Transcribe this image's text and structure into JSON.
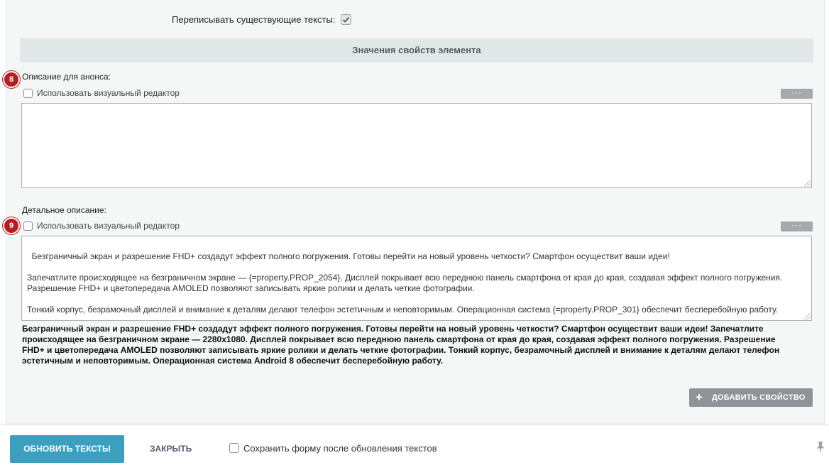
{
  "overwrite": {
    "label": "Переписывать существующие тексты:",
    "checked": true
  },
  "section": {
    "title": "Значения свойств элемента"
  },
  "preview_field": {
    "step": "8",
    "label": "Описание для анонса:",
    "visual_editor_label": "Использовать визуальный редактор",
    "more_label": "···",
    "value": ""
  },
  "detail_field": {
    "step": "9",
    "label": "Детальное описание:",
    "visual_editor_label": "Использовать визуальный редактор",
    "more_label": "···",
    "value": "Безграничный экран и разрешение FHD+ создадут эффект полного погружения. Готовы перейти на новый уровень четкости? Смартфон осуществит ваши идеи!\n\nЗапечатлите происходящее на безграничном экране — {=property.PROP_2054}. Дисплей покрывает всю переднюю панель смартфона от края до края, создавая эффект полного погружения. Разрешение FHD+ и цветопередача AMOLED позволяют записывать яркие ролики и делать четкие фотографии.\n\nТонкий корпус, безрамочный дисплей и внимание к деталям делают телефон эстетичным и неповторимым. Операционная система {=property.PROP_301} обеспечит бесперебойную работу.",
    "preview": "Безграничный экран и разрешение FHD+ создадут эффект полного погружения. Готовы перейти на новый уровень четкости? Смартфон осуществит ваши идеи! Запечатлите происходящее на безграничном экране — 2280x1080. Дисплей покрывает всю переднюю панель смартфона от края до края, создавая эффект полного погружения. Разрешение FHD+ и цветопередача AMOLED позволяют записывать яркие ролики и делать четкие фотографии. Тонкий корпус, безрамочный дисплей и внимание к деталям делают телефон эстетичным и неповторимым. Операционная система Android 8 обеспечит бесперебойную работу."
  },
  "add_property": {
    "icon": "plus-icon",
    "label": "ДОБАВИТЬ СВОЙСТВО"
  },
  "footer": {
    "update_label": "ОБНОВИТЬ ТЕКСТЫ",
    "close_label": "ЗАКРЫТЬ",
    "save_form_label": "Сохранить форму после обновления текстов",
    "save_form_checked": false,
    "pin_icon": "pin-icon"
  },
  "colors": {
    "primary": "#3ba0c0",
    "step_badge": "#b51e1e",
    "section_bg": "#e2e7e8",
    "secondary_button": "#8e9397"
  }
}
